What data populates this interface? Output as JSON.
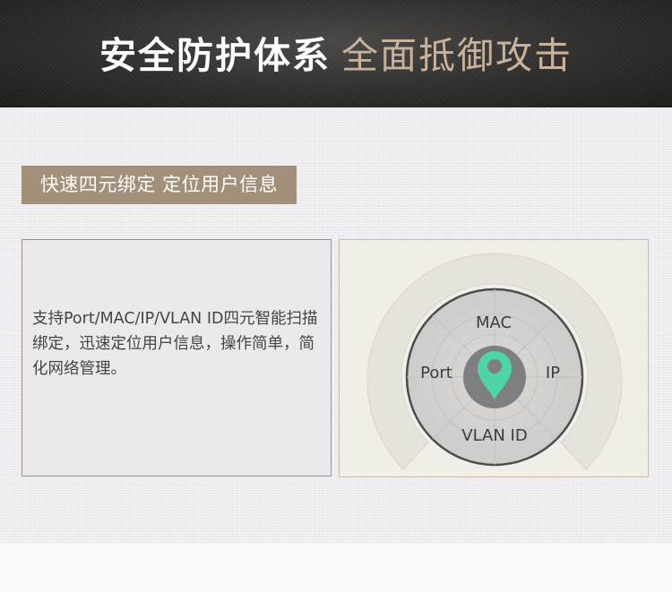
{
  "header": {
    "title_strong": "安全防护体系",
    "title_light": "全面抵御攻击"
  },
  "section": {
    "tag_label": "快速四元绑定 定位用户信息",
    "description": "支持Port/MAC/IP/VLAN ID四元智能扫描绑定，迅速定位用户信息，操作简单，简化网络管理。"
  },
  "diagram": {
    "labels": {
      "top": "MAC",
      "left": "Port",
      "right": "IP",
      "bottom": "VLAN ID"
    },
    "center_icon": "location-pin-icon"
  },
  "colors": {
    "accent": "#a3907a",
    "pin": "#4fd4a5"
  }
}
